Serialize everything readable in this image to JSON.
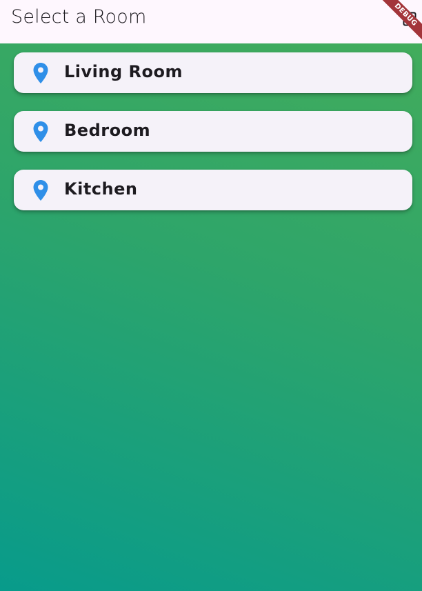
{
  "appbar": {
    "title": "Select a Room",
    "action_icon": "room-picker-icon"
  },
  "debug_banner": {
    "label": "DEBUG",
    "color": "#a3353a"
  },
  "rooms": [
    {
      "label": "Living Room",
      "icon": "location-pin-icon"
    },
    {
      "label": "Bedroom",
      "icon": "location-pin-icon"
    },
    {
      "label": "Kitchen",
      "icon": "location-pin-icon"
    }
  ],
  "colors": {
    "appbar_background": "#fef7fe",
    "card_background": "#f5f2f9",
    "pin_blue": "#2f8fe8",
    "text": "#1d1b20",
    "gradient_top": "#45ad5a",
    "gradient_bottom": "#089b8b"
  }
}
